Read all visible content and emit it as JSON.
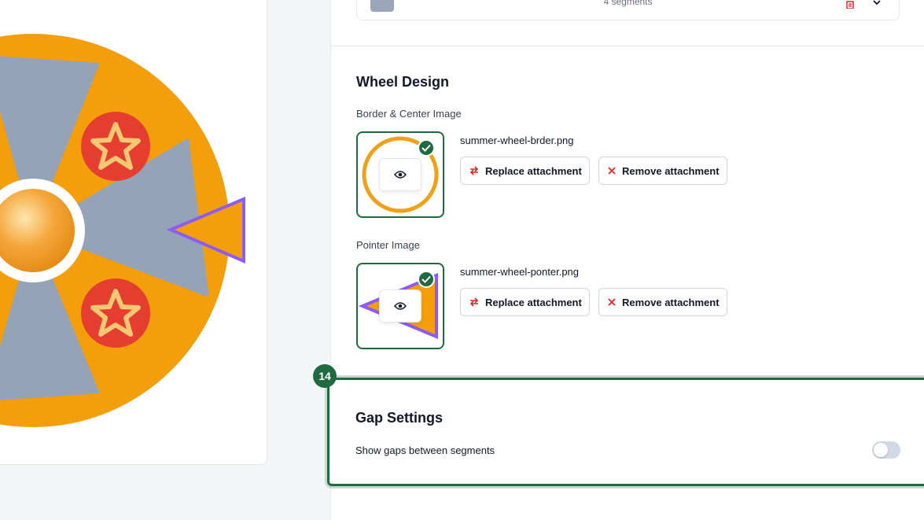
{
  "segments": {
    "count_label": "4 segments"
  },
  "wheel_design": {
    "title": "Wheel Design",
    "border_center": {
      "label": "Border & Center Image",
      "filename": "summer-wheel-brder.png",
      "replace_label": "Replace attachment",
      "remove_label": "Remove attachment"
    },
    "pointer": {
      "label": "Pointer Image",
      "filename": "summer-wheel-ponter.png",
      "replace_label": "Replace attachment",
      "remove_label": "Remove attachment"
    }
  },
  "gap_settings": {
    "step_number": "14",
    "title": "Gap Settings",
    "toggle_label": "Show gaps between segments",
    "toggle_on": false
  },
  "colors": {
    "accent_green": "#1f6b3f",
    "wheel_orange": "#f59e0b",
    "segment_gray": "#94a3b8",
    "star_red": "#e53d2f",
    "pointer_purple": "#8b5cf6",
    "remove_red": "#dc2626"
  }
}
